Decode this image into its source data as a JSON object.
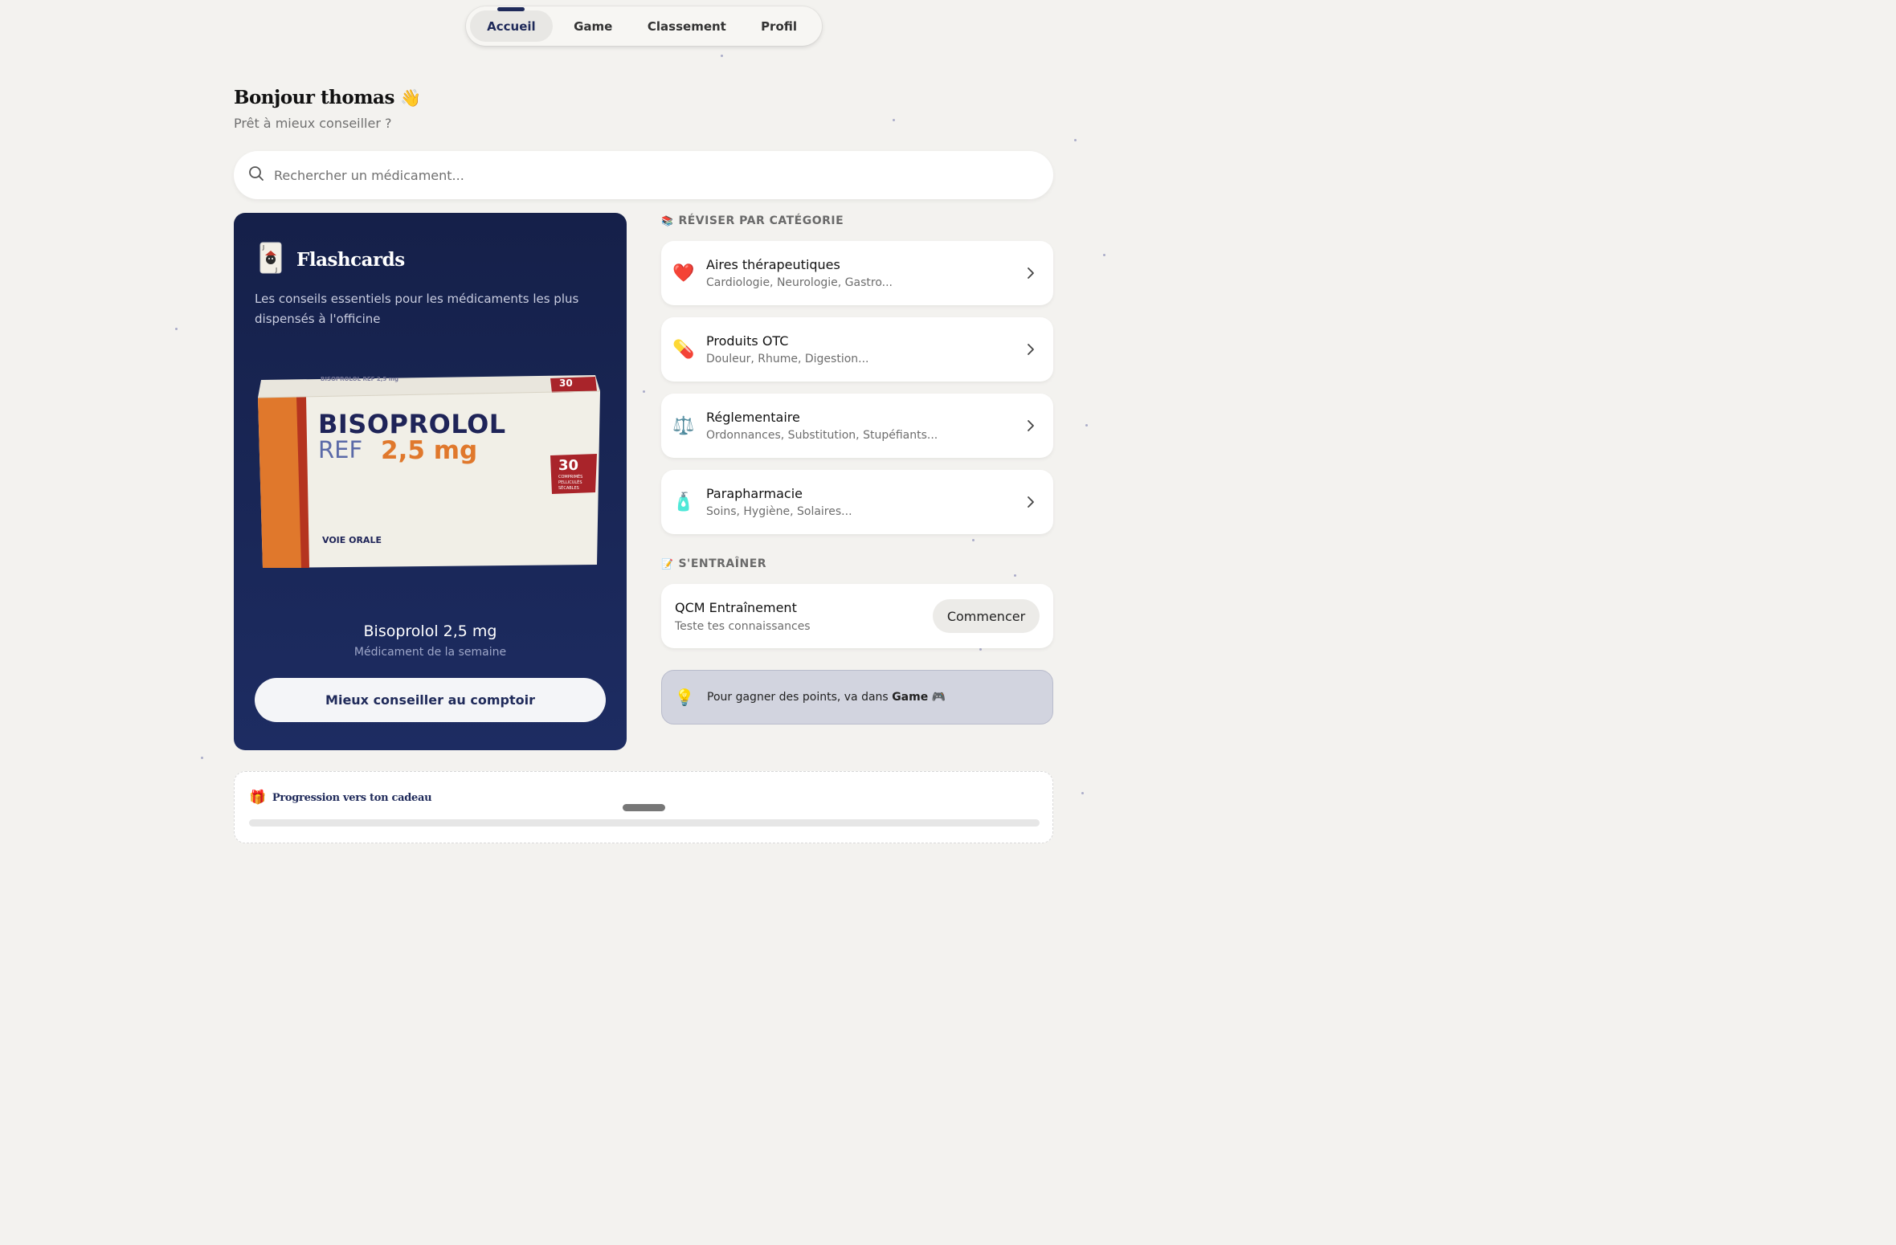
{
  "nav": {
    "tabs": [
      {
        "label": "Accueil",
        "active": true
      },
      {
        "label": "Game",
        "active": false
      },
      {
        "label": "Classement",
        "active": false
      },
      {
        "label": "Profil",
        "active": false
      }
    ]
  },
  "header": {
    "greeting": "Bonjour thomas",
    "greeting_emoji": "👋",
    "subtitle": "Prêt à mieux conseiller ?"
  },
  "search": {
    "placeholder": "Rechercher un médicament...",
    "icon": "search-icon"
  },
  "flashcards": {
    "title": "Flashcards",
    "icon": "joker-card-icon",
    "description": "Les conseils essentiels pour les médicaments les plus dispensés à l'officine",
    "box": {
      "top_text": "BISOPROLOL REF 2,5 mg",
      "brand": "BISOPROLOL",
      "ref": "REF",
      "dose": "2,5 mg",
      "count": "30",
      "count_label_1": "COMPRIMÉS",
      "count_label_2": "PELLICULÉS",
      "count_label_3": "SÉCABLES",
      "route": "VOIE ORALE"
    },
    "medication_name": "Bisoprolol 2,5 mg",
    "medication_subtitle": "Médicament de la semaine",
    "button_label": "Mieux conseiller au comptoir"
  },
  "categories": {
    "section_icon": "📚",
    "section_title": "RÉVISER PAR CATÉGORIE",
    "items": [
      {
        "icon": "❤️",
        "icon_name": "heart-icon",
        "label": "Aires thérapeutiques",
        "subtitle": "Cardiologie, Neurologie, Gastro..."
      },
      {
        "icon": "💊",
        "icon_name": "pill-icon",
        "label": "Produits OTC",
        "subtitle": "Douleur, Rhume, Digestion..."
      },
      {
        "icon": "⚖️",
        "icon_name": "scales-icon",
        "label": "Réglementaire",
        "subtitle": "Ordonnances, Substitution, Stupéfiants..."
      },
      {
        "icon": "🧴",
        "icon_name": "lotion-bottle-icon",
        "label": "Parapharmacie",
        "subtitle": "Soins, Hygiène, Solaires..."
      }
    ]
  },
  "training": {
    "section_icon": "📝",
    "section_title": "S'ENTRAÎNER",
    "qcm_title": "QCM Entraînement",
    "qcm_subtitle": "Teste tes connaissances",
    "qcm_button": "Commencer"
  },
  "tip": {
    "icon": "💡",
    "text_prefix": "Pour gagner des points, va dans ",
    "text_bold": "Game",
    "text_suffix_icon": "🎮"
  },
  "progress": {
    "icon": "🎁",
    "title": "Progression vers ton cadeau"
  },
  "colors": {
    "background": "#f3f2ef",
    "navy": "#1f2a5a",
    "flashcard_bg": "#152049",
    "tip_bg": "#d2d4df",
    "box_orange": "#e0782c",
    "box_red": "#a9242a"
  }
}
